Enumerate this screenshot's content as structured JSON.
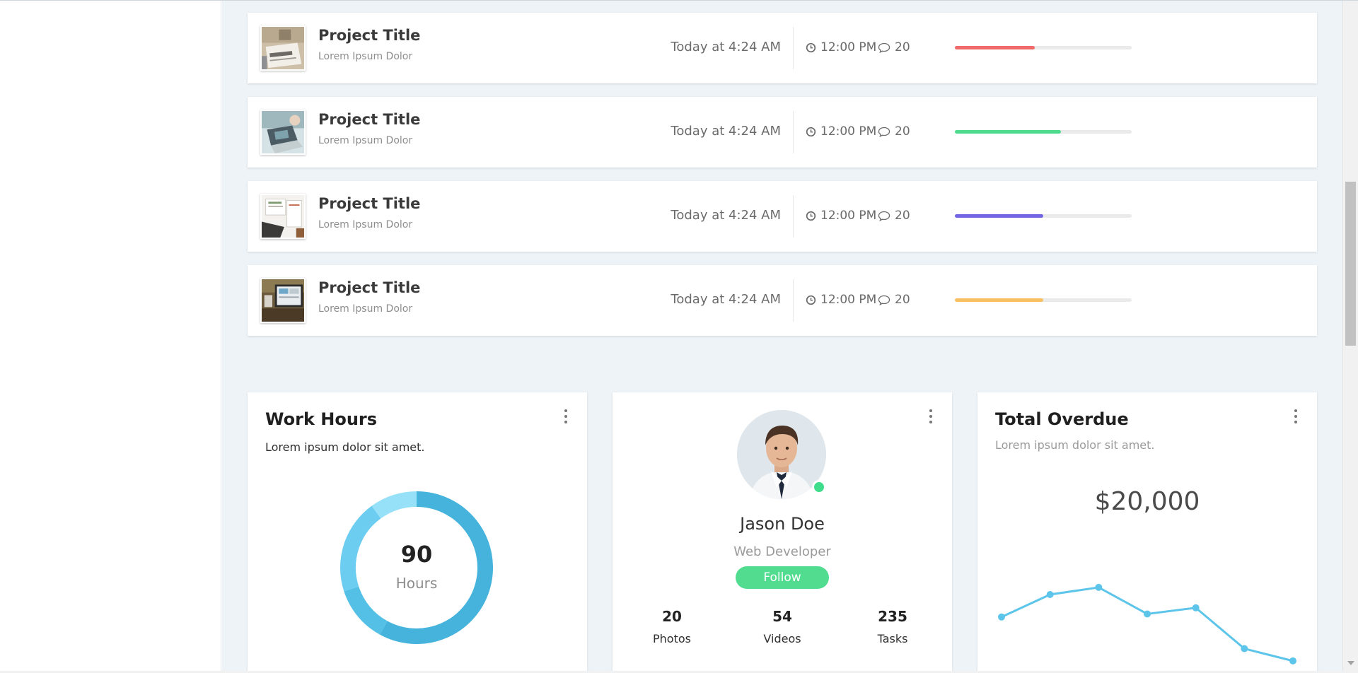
{
  "projects": [
    {
      "title": "Project Title",
      "subtitle": "Lorem Ipsum Dolor",
      "date": "Today at 4:24 AM",
      "time": "12:00 PM",
      "comments": "20",
      "progress": 0.45,
      "color": "#ef6b6b",
      "thumb": "business-newspaper-image"
    },
    {
      "title": "Project Title",
      "subtitle": "Lorem Ipsum Dolor",
      "date": "Today at 4:24 AM",
      "time": "12:00 PM",
      "comments": "20",
      "progress": 0.6,
      "color": "#4fdb8e",
      "thumb": "laptop-desk-image"
    },
    {
      "title": "Project Title",
      "subtitle": "Lorem Ipsum Dolor",
      "date": "Today at 4:24 AM",
      "time": "12:00 PM",
      "comments": "20",
      "progress": 0.5,
      "color": "#7265e3",
      "thumb": "documents-keyboard-image"
    },
    {
      "title": "Project Title",
      "subtitle": "Lorem Ipsum Dolor",
      "date": "Today at 4:24 AM",
      "time": "12:00 PM",
      "comments": "20",
      "progress": 0.5,
      "color": "#f7c163",
      "thumb": "tablet-charts-image"
    }
  ],
  "work_hours": {
    "title": "Work Hours",
    "subtitle": "Lorem ipsum dolor sit amet.",
    "value": "90",
    "unit": "Hours",
    "segments": [
      {
        "fraction": 0.58,
        "color": "#45b3db"
      },
      {
        "fraction": 0.12,
        "color": "#55c0e6"
      },
      {
        "fraction": 0.2,
        "color": "#6ccdf0"
      },
      {
        "fraction": 0.1,
        "color": "#96e0f8"
      }
    ]
  },
  "profile": {
    "name": "Jason Doe",
    "role": "Web Developer",
    "follow_label": "Follow",
    "status_color": "#3fdc8c",
    "stats": [
      {
        "value": "20",
        "label": "Photos"
      },
      {
        "value": "54",
        "label": "Videos"
      },
      {
        "value": "235",
        "label": "Tasks"
      }
    ]
  },
  "overdue": {
    "title": "Total Overdue",
    "subtitle": "Lorem ipsum dolor sit amet.",
    "amount": "$20,000",
    "line_color": "#5ec5ea",
    "points": [
      4.0,
      6.2,
      6.9,
      4.3,
      4.9,
      0.9,
      -0.3
    ]
  }
}
